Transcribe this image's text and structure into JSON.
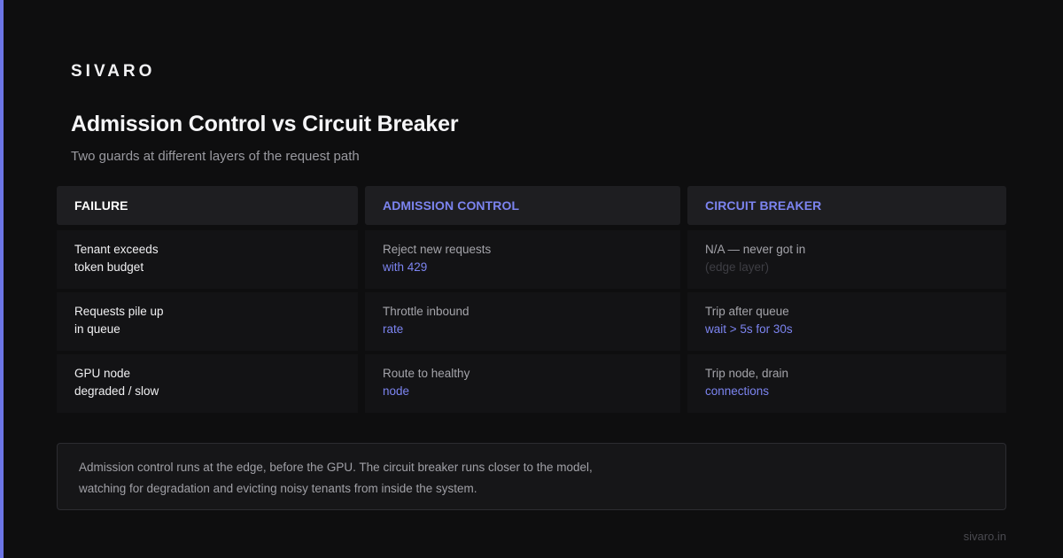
{
  "brand": "SIVARO",
  "title": "Admission Control vs Circuit Breaker",
  "subtitle": "Two guards at different layers of the request path",
  "colors": {
    "accent": "#7c84f0",
    "background": "#0e0e0f",
    "header_bg": "#1e1e21",
    "cell_bg": "#131315"
  },
  "columns": [
    {
      "header": "FAILURE"
    },
    {
      "header": "ADMISSION CONTROL"
    },
    {
      "header": "CIRCUIT BREAKER"
    }
  ],
  "rows": [
    {
      "failure": [
        "Tenant exceeds",
        "token budget"
      ],
      "admission": [
        "Reject new requests",
        "with 429"
      ],
      "breaker": [
        "N/A — never got in",
        "(edge layer)"
      ]
    },
    {
      "failure": [
        "Requests pile up",
        "in queue"
      ],
      "admission": [
        "Throttle inbound",
        "rate"
      ],
      "breaker": [
        "Trip after queue",
        "wait > 5s for 30s"
      ]
    },
    {
      "failure": [
        "GPU node",
        "degraded / slow"
      ],
      "admission": [
        "Route to healthy",
        "node"
      ],
      "breaker": [
        "Trip node, drain",
        "connections"
      ]
    }
  ],
  "note": [
    "Admission control runs at the edge, before the GPU. The circuit breaker runs closer to the model,",
    "watching for degradation and evicting noisy tenants from inside the system."
  ],
  "footer": "sivaro.in"
}
